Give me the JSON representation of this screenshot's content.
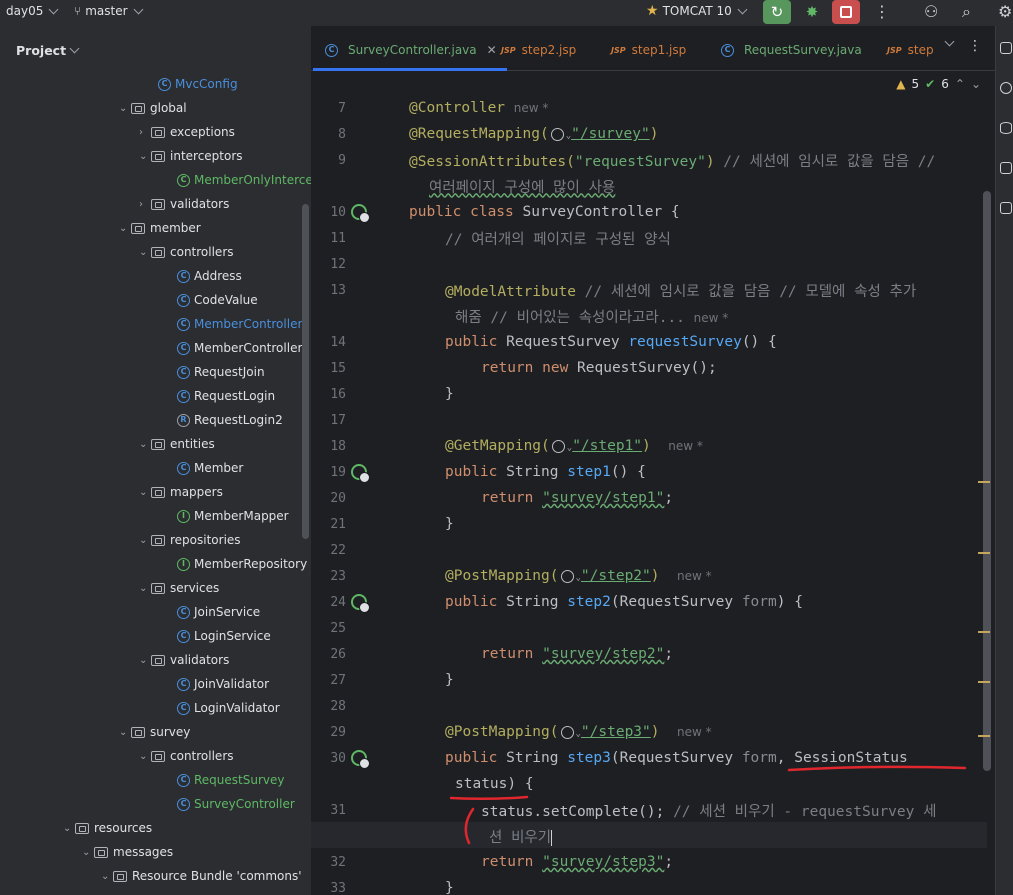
{
  "topbar": {
    "project_name": "day05",
    "branch": "master",
    "run_config": "TOMCAT 10"
  },
  "project_panel": {
    "title": "Project",
    "tree": [
      {
        "label": "MvcConfig",
        "kind": "class-blue"
      },
      {
        "label": "global",
        "kind": "folder"
      },
      {
        "label": "exceptions",
        "kind": "folder"
      },
      {
        "label": "interceptors",
        "kind": "folder"
      },
      {
        "label": "MemberOnlyIntercept",
        "kind": "class-green"
      },
      {
        "label": "validators",
        "kind": "folder"
      },
      {
        "label": "member",
        "kind": "folder"
      },
      {
        "label": "controllers",
        "kind": "folder"
      },
      {
        "label": "Address",
        "kind": "class"
      },
      {
        "label": "CodeValue",
        "kind": "class"
      },
      {
        "label": "MemberController",
        "kind": "class-blue"
      },
      {
        "label": "MemberController2",
        "kind": "class"
      },
      {
        "label": "RequestJoin",
        "kind": "class"
      },
      {
        "label": "RequestLogin",
        "kind": "class"
      },
      {
        "label": "RequestLogin2",
        "kind": "record"
      },
      {
        "label": "entities",
        "kind": "folder"
      },
      {
        "label": "Member",
        "kind": "class"
      },
      {
        "label": "mappers",
        "kind": "folder"
      },
      {
        "label": "MemberMapper",
        "kind": "interface"
      },
      {
        "label": "repositories",
        "kind": "folder"
      },
      {
        "label": "MemberRepository",
        "kind": "interface"
      },
      {
        "label": "services",
        "kind": "folder"
      },
      {
        "label": "JoinService",
        "kind": "class"
      },
      {
        "label": "LoginService",
        "kind": "class"
      },
      {
        "label": "validators",
        "kind": "folder"
      },
      {
        "label": "JoinValidator",
        "kind": "class"
      },
      {
        "label": "LoginValidator",
        "kind": "class"
      },
      {
        "label": "survey",
        "kind": "folder"
      },
      {
        "label": "controllers",
        "kind": "folder"
      },
      {
        "label": "RequestSurvey",
        "kind": "class-green"
      },
      {
        "label": "SurveyController",
        "kind": "class-green"
      },
      {
        "label": "resources",
        "kind": "folder"
      },
      {
        "label": "messages",
        "kind": "folder"
      },
      {
        "label": "Resource Bundle 'commons'",
        "kind": "bundle"
      }
    ]
  },
  "tabs": [
    {
      "label": "SurveyController.java",
      "active": true
    },
    {
      "label": "step2.jsp"
    },
    {
      "label": "step1.jsp"
    },
    {
      "label": "RequestSurvey.java"
    },
    {
      "label": "step"
    }
  ],
  "editor": {
    "warnings": "5",
    "ok_count": "6",
    "line_numbers": [
      "7",
      "8",
      "9",
      "",
      "10",
      "11",
      "12",
      "13",
      "",
      "14",
      "15",
      "16",
      "17",
      "18",
      "19",
      "20",
      "21",
      "22",
      "23",
      "24",
      "25",
      "26",
      "27",
      "28",
      "29",
      "30",
      "",
      "31",
      "",
      "32",
      "33"
    ],
    "hints": {
      "new": "new *"
    },
    "lines": {
      "l7_ann": "@Controller",
      "l8_ann": "@RequestMapping(",
      "l8_str": "\"/survey\"",
      "l8_end": ")",
      "l9_ann": "@SessionAttributes(",
      "l9_str": "\"requestSurvey\"",
      "l9_end": ") ",
      "l9_cm": "// 세션에 임시로 값을 담음 //",
      "l9b_cm": "여러페이지 구성에 많이 사용",
      "l10_k": "public class ",
      "l10_name": "SurveyController {",
      "l11_cm": "// 여러개의 페이지로 구성된 양식",
      "l13_ann": "@ModelAttribute",
      "l13_cm": " // 세션에 임시로 값을 담음 // 모델에 속성 추가",
      "l13b_cm": "해줌 // 비어있는 속성이라고라...",
      "l14_k": "public ",
      "l14_type": "RequestSurvey ",
      "l14_fn": "requestSurvey",
      "l14_end": "() {",
      "l15_k": "return new ",
      "l15_rest": "RequestSurvey();",
      "close": "}",
      "l18_ann": "@GetMapping(",
      "l18_str": "\"/step1\"",
      "l18_end": ")",
      "l19_k": "public ",
      "l19_type": "String ",
      "l19_fn": "step1",
      "l19_end": "() {",
      "ret": "return ",
      "l20_str": "\"survey/step1\"",
      "semi": ";",
      "l23_ann": "@PostMapping(",
      "l23_str": "\"/step2\"",
      "l23_end": ")",
      "l24_fn": "step2",
      "l24_mid": "(RequestSurvey ",
      "l24_par": "form",
      "l24_end": ") {",
      "l26_str": "\"survey/step2\"",
      "l29_ann": "@PostMapping(",
      "l29_str": "\"/step3\"",
      "l29_end": ")",
      "l30_fn": "step3",
      "l30_mid": "(RequestSurvey ",
      "l30_par": "form",
      "l30_end": ", SessionStatus",
      "l30b": "status) {",
      "l31_code": "status.setComplete(); ",
      "l31_cm": "// 세션 비우기 - requestSurvey 세",
      "l31b_cm": "션 비우기",
      "l32_str": "\"survey/step3\"",
      "l33": "}"
    }
  },
  "colors": {
    "accent": "#3574f0",
    "annotation": "#b3ae60",
    "keyword": "#cf8e6d",
    "string": "#6aab73",
    "comment": "#7a7e85",
    "function": "#56a8f5",
    "red_markup": "#e0272e"
  }
}
